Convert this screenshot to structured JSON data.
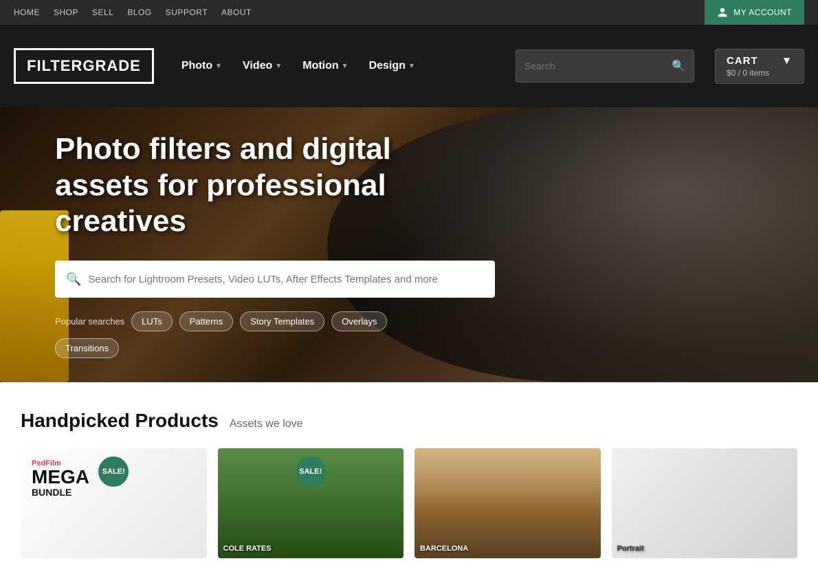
{
  "topbar": {
    "nav": [
      {
        "label": "HOME",
        "href": "#"
      },
      {
        "label": "SHOP",
        "href": "#"
      },
      {
        "label": "SELL",
        "href": "#"
      },
      {
        "label": "BLOG",
        "href": "#"
      },
      {
        "label": "SUPPORT",
        "href": "#"
      },
      {
        "label": "ABOUT",
        "href": "#"
      }
    ],
    "account_label": "MY ACCOUNT"
  },
  "header": {
    "logo": "FILTERGRADE",
    "nav": [
      {
        "label": "Photo",
        "has_dropdown": true
      },
      {
        "label": "Video",
        "has_dropdown": true
      },
      {
        "label": "Motion",
        "has_dropdown": true
      },
      {
        "label": "Design",
        "has_dropdown": true
      }
    ],
    "search_placeholder": "Search",
    "cart": {
      "label": "CART",
      "price": "$0",
      "items": "/ 0 items"
    }
  },
  "hero": {
    "title": "Photo filters and digital assets for professional creatives",
    "search_placeholder": "Search for Lightroom Presets, Video LUTs, After Effects Templates and more",
    "popular_label": "Popular searches",
    "tags": [
      {
        "label": "LUTs"
      },
      {
        "label": "Patterns"
      },
      {
        "label": "Story Templates"
      },
      {
        "label": "Overlays"
      },
      {
        "label": "Transitions"
      }
    ]
  },
  "products": {
    "title": "Handpicked Products",
    "subtitle": "Assets we love",
    "cards": [
      {
        "id": "card1",
        "sale": true,
        "sale_label": "SALE!",
        "brand": "PsdFilm",
        "name": "MEGA",
        "sub": "BUNDLE"
      },
      {
        "id": "card2",
        "sale": true,
        "sale_label": "SALE!",
        "name": "COLE RATES"
      },
      {
        "id": "card3",
        "sale": false,
        "name": "BARCELONA"
      },
      {
        "id": "card4",
        "sale": false,
        "name": "Portrait"
      }
    ]
  }
}
